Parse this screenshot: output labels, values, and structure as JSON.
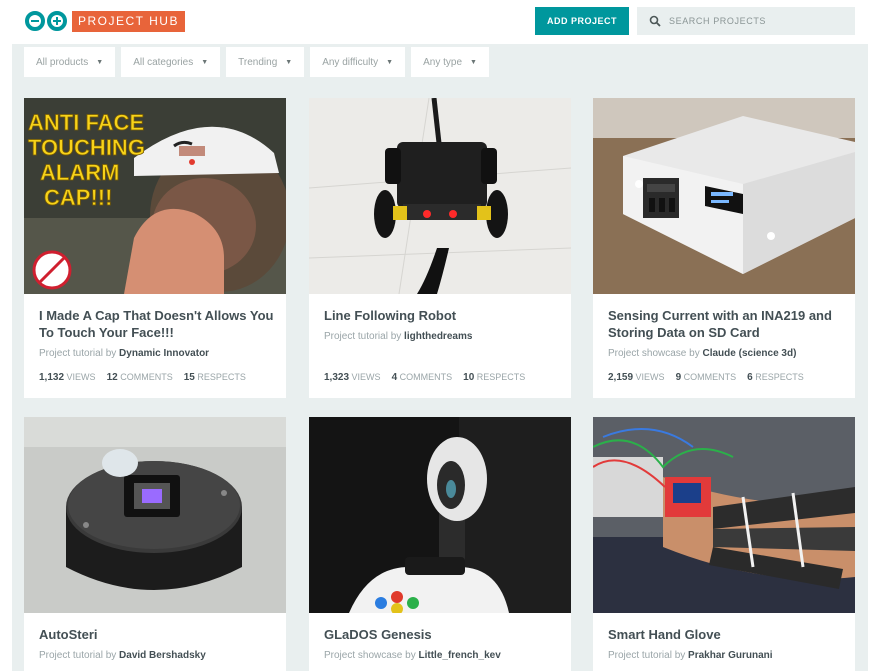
{
  "header": {
    "brand_label": "PROJECT HUB",
    "add_project_label": "ADD PROJECT",
    "search_placeholder": "SEARCH PROJECTS",
    "accent_color": "#00979d",
    "brand_color": "#e8643a"
  },
  "filters": [
    {
      "label": "All products"
    },
    {
      "label": "All categories"
    },
    {
      "label": "Trending"
    },
    {
      "label": "Any difficulty"
    },
    {
      "label": "Any type"
    }
  ],
  "projects": [
    {
      "title": "I Made A Cap That Doesn't Allows You To Touch Your Face!!!",
      "type": "Project tutorial",
      "by": "by",
      "author": "Dynamic Innovator",
      "views": "1,132",
      "comments": "12",
      "respects": "15",
      "views_label": "VIEWS",
      "comments_label": "COMMENTS",
      "respects_label": "RESPECTS",
      "thumb_text": [
        "ANTI FACE",
        "TOUCHING",
        "ALARM",
        "CAP!!!"
      ]
    },
    {
      "title": "Line Following Robot",
      "type": "Project tutorial",
      "by": "by",
      "author": "lighthedreams",
      "views": "1,323",
      "comments": "4",
      "respects": "10",
      "views_label": "VIEWS",
      "comments_label": "COMMENTS",
      "respects_label": "RESPECTS"
    },
    {
      "title": "Sensing Current with an INA219 and Storing Data on SD Card",
      "type": "Project showcase",
      "by": "by",
      "author": "Claude (science 3d)",
      "views": "2,159",
      "comments": "9",
      "respects": "6",
      "views_label": "VIEWS",
      "comments_label": "COMMENTS",
      "respects_label": "RESPECTS"
    },
    {
      "title": "AutoSteri",
      "type": "Project tutorial",
      "by": "by",
      "author": "David Bershadsky"
    },
    {
      "title": "GLaDOS Genesis",
      "type": "Project showcase",
      "by": "by",
      "author": "Little_french_kev"
    },
    {
      "title": "Smart Hand Glove",
      "type": "Project tutorial",
      "by": "by",
      "author": "Prakhar Gurunani"
    }
  ]
}
